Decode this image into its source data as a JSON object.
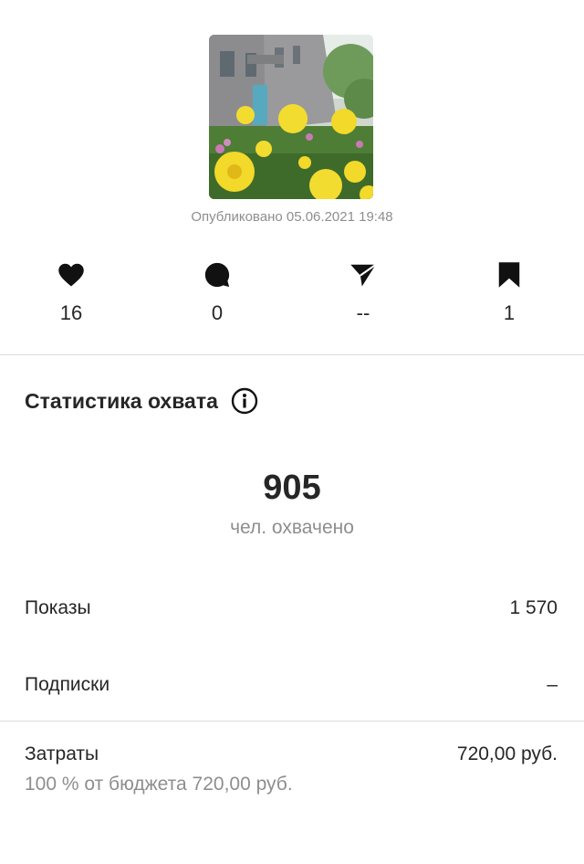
{
  "post": {
    "published": "Опубликовано 05.06.2021 19:48"
  },
  "metrics": [
    {
      "icon": "heart-icon",
      "value": "16"
    },
    {
      "icon": "comment-icon",
      "value": "0"
    },
    {
      "icon": "share-icon",
      "value": "--"
    },
    {
      "icon": "bookmark-icon",
      "value": "1"
    }
  ],
  "reach": {
    "title": "Статистика охвата",
    "number": "905",
    "label": "чел. охвачено"
  },
  "rows": {
    "impressions": {
      "label": "Показы",
      "value": "1 570"
    },
    "follows": {
      "label": "Подписки",
      "value": "–"
    },
    "spend": {
      "label": "Затраты",
      "value": "720,00 руб.",
      "sub": "100 % от бюджета 720,00 руб."
    }
  }
}
